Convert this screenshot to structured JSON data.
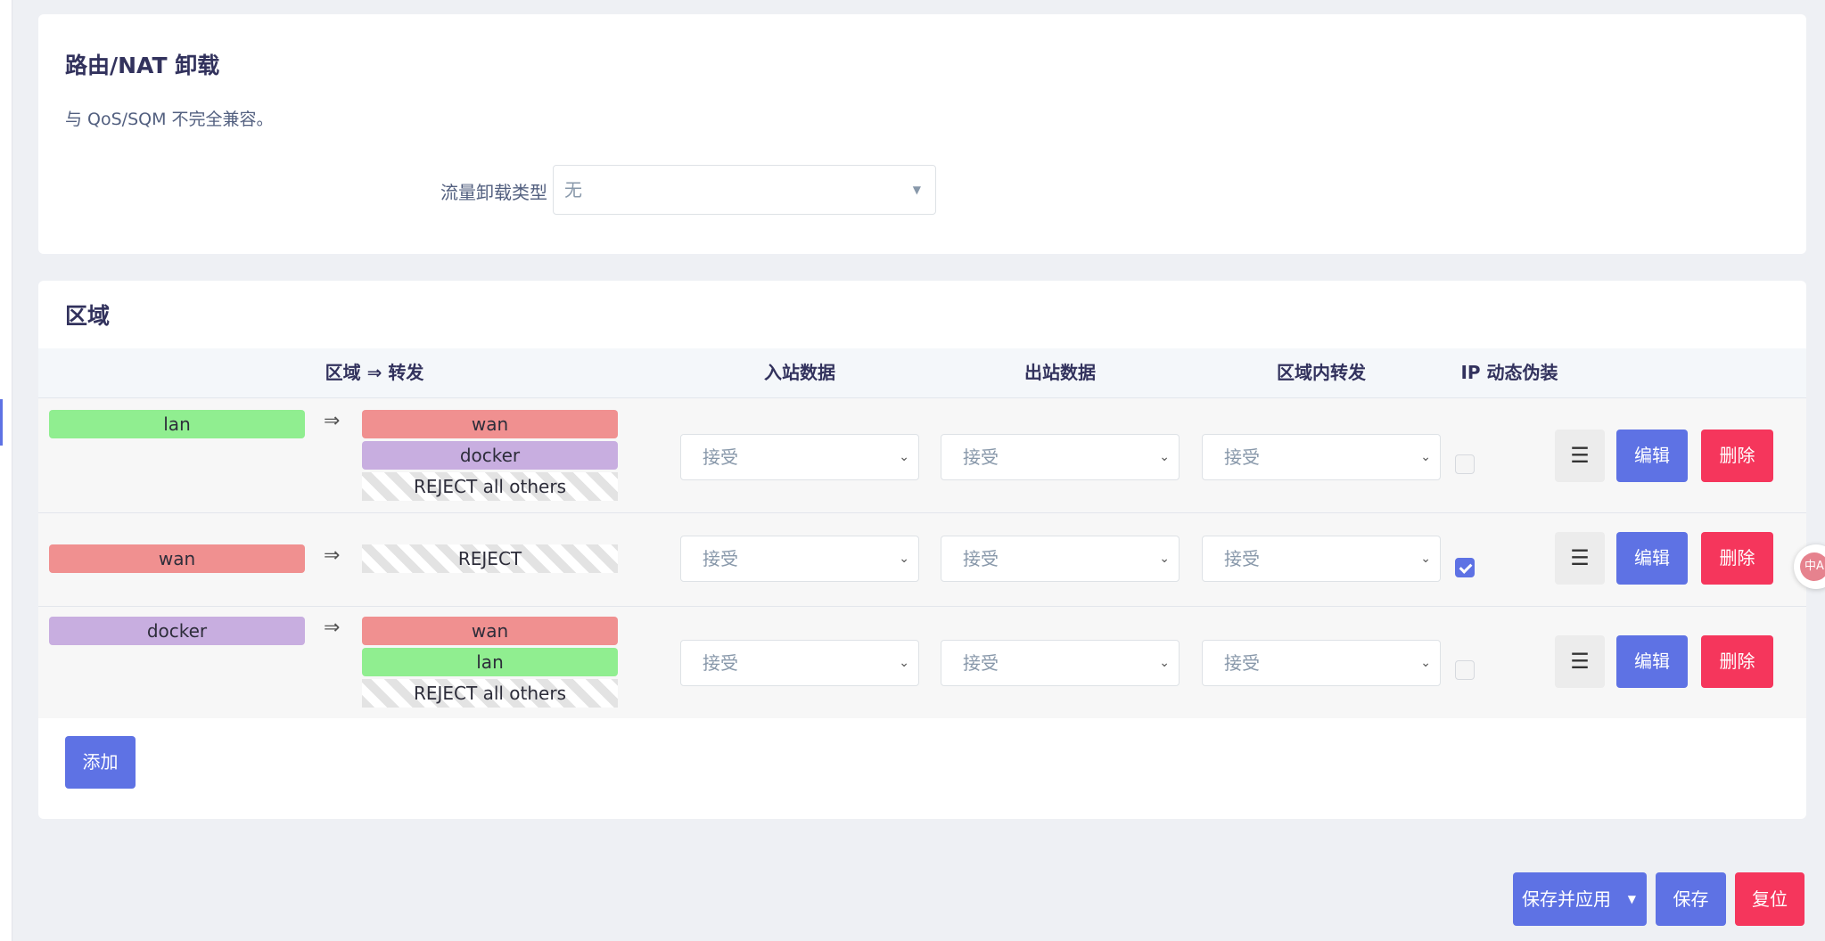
{
  "offload": {
    "title": "路由/NAT 卸载",
    "description": "与 QoS/SQM 不完全兼容。",
    "flow_offload_label": "流量卸载类型",
    "flow_offload_value": "无"
  },
  "zones": {
    "title": "区域",
    "headers": {
      "zone_forward": "区域 ⇒ 转发",
      "input": "入站数据",
      "output": "出站数据",
      "forward": "区域内转发",
      "masq": "IP 动态伪装"
    },
    "arrow": "⇒",
    "rows": [
      {
        "zone": "lan",
        "targets": [
          "wan",
          "docker"
        ],
        "reject": "REJECT all others",
        "input": "接受",
        "output": "接受",
        "forward": "接受",
        "masq": false
      },
      {
        "zone": "wan",
        "targets": [],
        "reject": "REJECT",
        "input": "接受",
        "output": "接受",
        "forward": "接受",
        "masq": true
      },
      {
        "zone": "docker",
        "targets": [
          "wan",
          "lan"
        ],
        "reject": "REJECT all others",
        "input": "接受",
        "output": "接受",
        "forward": "接受",
        "masq": false
      }
    ],
    "row_actions": {
      "menu": "☰",
      "edit": "编辑",
      "delete": "删除"
    },
    "add_label": "添加"
  },
  "footer": {
    "save_apply": "保存并应用",
    "save": "保存",
    "reset": "复位"
  },
  "floating_badge": "中A",
  "colors": {
    "lan": "#90ee90",
    "wan": "#f09090",
    "docker": "#c8aee0",
    "primary": "#5e72e4",
    "danger": "#f5365c"
  }
}
